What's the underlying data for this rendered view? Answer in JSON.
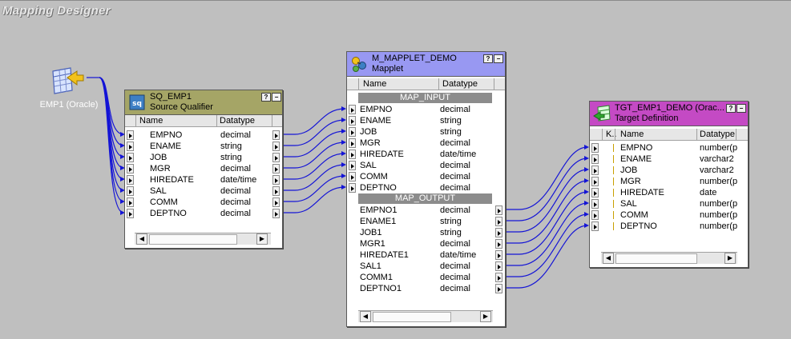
{
  "canvas": {
    "title": "Mapping Designer"
  },
  "source": {
    "label": "EMP1 (Oracle)"
  },
  "source_qualifier": {
    "name": "SQ_EMP1",
    "type": "Source Qualifier",
    "columns": {
      "name": "Name",
      "datatype": "Datatype"
    },
    "ports": [
      {
        "name": "EMPNO",
        "datatype": "decimal"
      },
      {
        "name": "ENAME",
        "datatype": "string"
      },
      {
        "name": "JOB",
        "datatype": "string"
      },
      {
        "name": "MGR",
        "datatype": "decimal"
      },
      {
        "name": "HIREDATE",
        "datatype": "date/time"
      },
      {
        "name": "SAL",
        "datatype": "decimal"
      },
      {
        "name": "COMM",
        "datatype": "decimal"
      },
      {
        "name": "DEPTNO",
        "datatype": "decimal"
      }
    ]
  },
  "mapplet": {
    "name": "M_MAPPLET_DEMO",
    "type": "Mapplet",
    "columns": {
      "name": "Name",
      "datatype": "Datatype"
    },
    "input_group": "MAP_INPUT",
    "output_group": "MAP_OUTPUT",
    "input_ports": [
      {
        "name": "EMPNO",
        "datatype": "decimal"
      },
      {
        "name": "ENAME",
        "datatype": "string"
      },
      {
        "name": "JOB",
        "datatype": "string"
      },
      {
        "name": "MGR",
        "datatype": "decimal"
      },
      {
        "name": "HIREDATE",
        "datatype": "date/time"
      },
      {
        "name": "SAL",
        "datatype": "decimal"
      },
      {
        "name": "COMM",
        "datatype": "decimal"
      },
      {
        "name": "DEPTNO",
        "datatype": "decimal"
      }
    ],
    "output_ports": [
      {
        "name": "EMPNO1",
        "datatype": "decimal"
      },
      {
        "name": "ENAME1",
        "datatype": "string"
      },
      {
        "name": "JOB1",
        "datatype": "string"
      },
      {
        "name": "MGR1",
        "datatype": "decimal"
      },
      {
        "name": "HIREDATE1",
        "datatype": "date/time"
      },
      {
        "name": "SAL1",
        "datatype": "decimal"
      },
      {
        "name": "COMM1",
        "datatype": "decimal"
      },
      {
        "name": "DEPTNO1",
        "datatype": "decimal"
      }
    ]
  },
  "target": {
    "name": "TGT_EMP1_DEMO (Orac...",
    "type": "Target Definition",
    "columns": {
      "key": "K..",
      "name": "Name",
      "datatype": "Datatype"
    },
    "ports": [
      {
        "name": "EMPNO",
        "datatype": "number(p"
      },
      {
        "name": "ENAME",
        "datatype": "varchar2"
      },
      {
        "name": "JOB",
        "datatype": "varchar2"
      },
      {
        "name": "MGR",
        "datatype": "number(p"
      },
      {
        "name": "HIREDATE",
        "datatype": "date"
      },
      {
        "name": "SAL",
        "datatype": "number(p"
      },
      {
        "name": "COMM",
        "datatype": "number(p"
      },
      {
        "name": "DEPTNO",
        "datatype": "number(p"
      }
    ]
  },
  "buttons": {
    "restore": "?",
    "minimize": "−"
  },
  "colors": {
    "sq_title": "#a5a566",
    "mapplet_title": "#9898f2",
    "target_title": "#c44ac4",
    "link": "#1414d6"
  }
}
